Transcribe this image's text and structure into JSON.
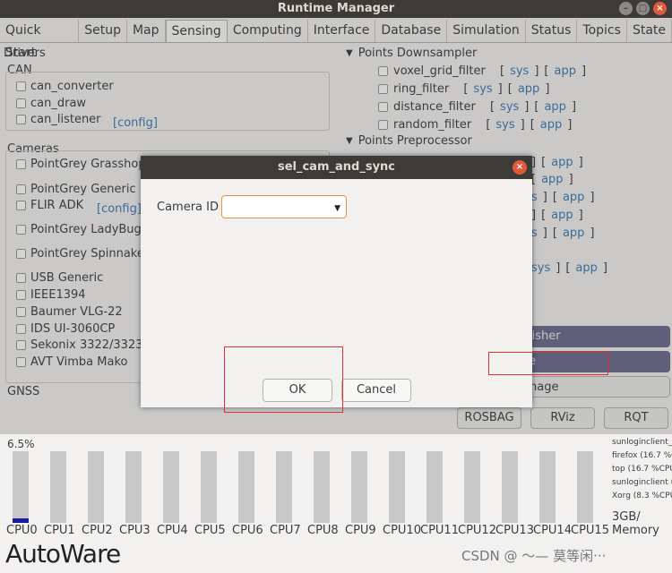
{
  "window": {
    "title": "Runtime Manager"
  },
  "tabs": [
    "Quick Start",
    "Setup",
    "Map",
    "Sensing",
    "Computing",
    "Interface",
    "Database",
    "Simulation",
    "Status",
    "Topics",
    "State"
  ],
  "left": {
    "drivers": "Drivers",
    "can": "CAN",
    "can_items": [
      "can_converter",
      "can_draw",
      "can_listener"
    ],
    "config": "[config]",
    "cameras": "Cameras",
    "camera_items": [
      "PointGrey Grasshop",
      "PointGrey Generic",
      "FLIR ADK",
      "PointGrey LadyBug 5",
      "PointGrey Spinnake",
      "USB Generic",
      "IEEE1394",
      "Baumer VLG-22",
      "IDS UI-3060CP",
      "Sekonix 3322/3323 c",
      "AVT Vimba Mako"
    ],
    "gnss": "GNSS"
  },
  "right": {
    "downsampler": "Points Downsampler",
    "down_items": [
      "voxel_grid_filter",
      "ring_filter",
      "distance_filter",
      "random_filter"
    ],
    "preprocessor": "Points Preprocessor",
    "sys": "sys",
    "app": "app",
    "lb": "[",
    "rb": "]",
    "sys_partial": "s",
    "sys_partial2": "ys",
    "buttons": [
      "lisher",
      "e",
      "nage"
    ],
    "rosbag": "ROSBAG",
    "rviz": "RViz",
    "rqt": "RQT"
  },
  "dialog": {
    "title": "sel_cam_and_sync",
    "camera_label": "Camera ID",
    "camera_value": "",
    "ok": "OK",
    "cancel": "Cancel"
  },
  "status": {
    "cpu_percent": "6.5%",
    "cpu_labels": [
      "CPU0",
      "CPU1",
      "CPU2",
      "CPU3",
      "CPU4",
      "CPU5",
      "CPU6",
      "CPU7",
      "CPU8",
      "CPU9",
      "CPU10",
      "CPU11",
      "CPU12",
      "CPU13",
      "CPU14",
      "CPU15"
    ],
    "cpu0_usage": 0.065,
    "processes": [
      "sunloginclient_",
      "firefox (16.7 %C",
      "top (16.7 %CPU",
      "sunloginclient (",
      "Xorg (8.3 %CPU"
    ],
    "memory_value": "3GB/",
    "memory_label": "Memory",
    "logo": "AutoWare",
    "watermark": "CSDN @ 〜— 莫等闲···"
  },
  "colors": {
    "accent": "#3b79b3",
    "purple": "#6b6a8e",
    "dialog_focus": "#e8953a",
    "annotation": "#e03030"
  }
}
